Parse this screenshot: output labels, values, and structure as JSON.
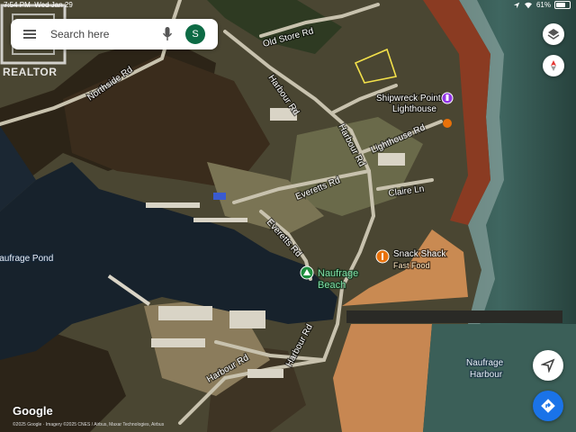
{
  "status_bar": {
    "time": "7:54 PM",
    "day": "Wed Jan 29",
    "battery": "61%"
  },
  "search": {
    "placeholder": "Search here",
    "avatar_initial": "S"
  },
  "watermark": {
    "text": "REALTOR"
  },
  "map": {
    "roads": {
      "northside": "Northside Rd",
      "old_store": "Old Store Rd",
      "harbour_upper": "Harbour Rd",
      "harbour_mid": "Harbour Rd",
      "lighthouse": "Lighthouse Rd",
      "everetts_upper": "Everetts Rd",
      "everetts_lower": "Everetts Rd",
      "claire": "Claire Ln",
      "harbour_bottom_left": "Harbour Rd",
      "harbour_bottom_right": "Harbour Rd"
    },
    "water": {
      "pond": "Naufrage Pond",
      "harbour_line1": "Naufrage",
      "harbour_line2": "Harbour"
    },
    "pois": {
      "lighthouse_line1": "Shipwreck Point",
      "lighthouse_line2": "Lighthouse",
      "snack_name": "Snack Shack",
      "snack_sub": "Fast Food",
      "beach_line1": "Naufrage",
      "beach_line2": "Beach"
    }
  },
  "footer": {
    "google": "Google",
    "copyright": "©2025 Google · Imagery ©2025 CNES / Airbus, Maxar Technologies, Airbus"
  },
  "colors": {
    "poi_green": "#1e8e3e",
    "poi_purple": "#9334e6",
    "poi_orange": "#e8710a",
    "directions_blue": "#1a73e8"
  },
  "icons": [
    "menu-icon",
    "mic-icon",
    "layers-icon",
    "compass-icon",
    "locate-icon",
    "directions-icon"
  ]
}
